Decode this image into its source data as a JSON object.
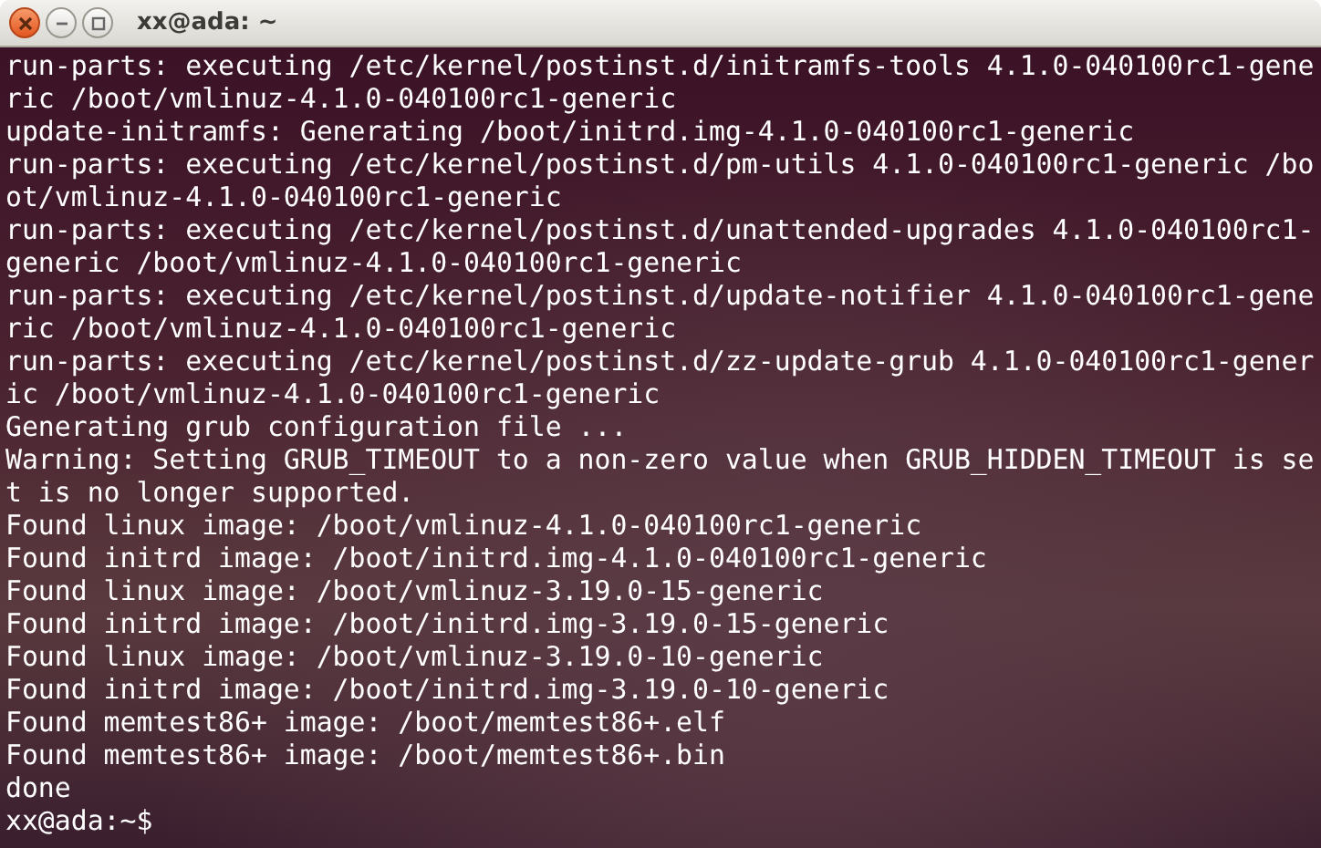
{
  "window": {
    "title": "xx@ada: ~"
  },
  "terminal": {
    "lines": [
      "run-parts: executing /etc/kernel/postinst.d/initramfs-tools 4.1.0-040100rc1-gene",
      "ric /boot/vmlinuz-4.1.0-040100rc1-generic",
      "update-initramfs: Generating /boot/initrd.img-4.1.0-040100rc1-generic",
      "run-parts: executing /etc/kernel/postinst.d/pm-utils 4.1.0-040100rc1-generic /bo",
      "ot/vmlinuz-4.1.0-040100rc1-generic",
      "run-parts: executing /etc/kernel/postinst.d/unattended-upgrades 4.1.0-040100rc1-",
      "generic /boot/vmlinuz-4.1.0-040100rc1-generic",
      "run-parts: executing /etc/kernel/postinst.d/update-notifier 4.1.0-040100rc1-gene",
      "ric /boot/vmlinuz-4.1.0-040100rc1-generic",
      "run-parts: executing /etc/kernel/postinst.d/zz-update-grub 4.1.0-040100rc1-gener",
      "ic /boot/vmlinuz-4.1.0-040100rc1-generic",
      "Generating grub configuration file ...",
      "Warning: Setting GRUB_TIMEOUT to a non-zero value when GRUB_HIDDEN_TIMEOUT is se",
      "t is no longer supported.",
      "Found linux image: /boot/vmlinuz-4.1.0-040100rc1-generic",
      "Found initrd image: /boot/initrd.img-4.1.0-040100rc1-generic",
      "Found linux image: /boot/vmlinuz-3.19.0-15-generic",
      "Found initrd image: /boot/initrd.img-3.19.0-15-generic",
      "Found linux image: /boot/vmlinuz-3.19.0-10-generic",
      "Found initrd image: /boot/initrd.img-3.19.0-10-generic",
      "Found memtest86+ image: /boot/memtest86+.elf",
      "Found memtest86+ image: /boot/memtest86+.bin",
      "done",
      "xx@ada:~$"
    ]
  }
}
